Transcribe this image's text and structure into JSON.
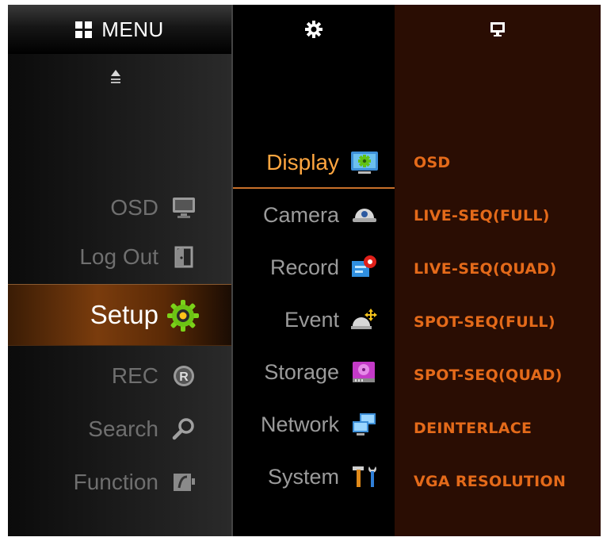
{
  "menu": {
    "title": "MENU",
    "icon": "grid-icon",
    "scroll_indicator": "scroll-up-icon",
    "items": [
      {
        "label": "OSD",
        "icon": "monitor-icon",
        "active": false
      },
      {
        "label": "Log Out",
        "icon": "logout-door-icon",
        "active": false
      },
      {
        "label": "Setup",
        "icon": "gear-icon",
        "active": true
      },
      {
        "label": "REC",
        "icon": "record-r-icon",
        "active": false
      },
      {
        "label": "Search",
        "icon": "magnifier-icon",
        "active": false
      },
      {
        "label": "Function",
        "icon": "function-icon",
        "active": false
      }
    ]
  },
  "setup": {
    "header_icon": "gear-icon",
    "items": [
      {
        "label": "Display",
        "icon": "display-settings-icon",
        "active": true
      },
      {
        "label": "Camera",
        "icon": "dome-camera-icon",
        "active": false
      },
      {
        "label": "Record",
        "icon": "record-settings-icon",
        "active": false
      },
      {
        "label": "Event",
        "icon": "event-motion-icon",
        "active": false
      },
      {
        "label": "Storage",
        "icon": "hard-drive-icon",
        "active": false
      },
      {
        "label": "Network",
        "icon": "network-computers-icon",
        "active": false
      },
      {
        "label": "System",
        "icon": "tools-icon",
        "active": false
      }
    ]
  },
  "display": {
    "header_icon": "monitor-icon",
    "items": [
      "OSD",
      "LIVE-SEQ(FULL)",
      "LIVE-SEQ(QUAD)",
      "SPOT-SEQ(FULL)",
      "SPOT-SEQ(QUAD)",
      "DEINTERLACE",
      "VGA RESOLUTION"
    ]
  },
  "colors": {
    "accent_orange": "#e46a1a",
    "active_label": "#ffa640",
    "panel_brown": "#2a0d03"
  }
}
